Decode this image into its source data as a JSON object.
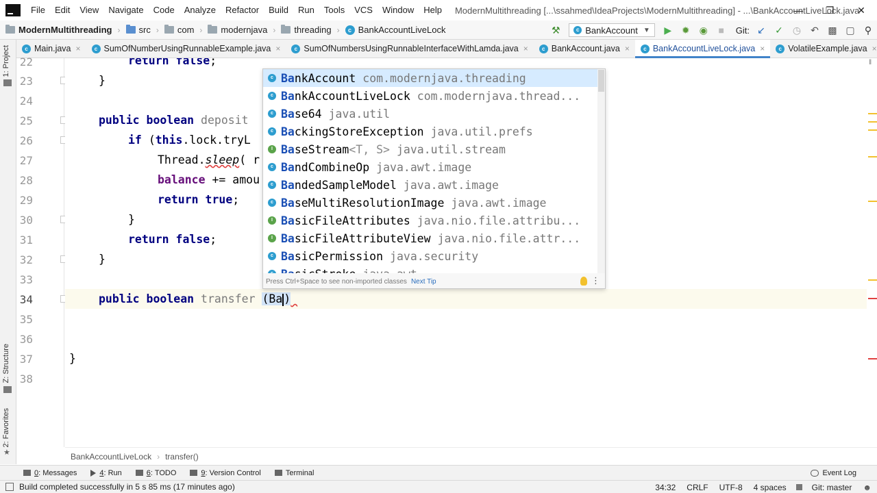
{
  "menu": {
    "items": [
      {
        "label": "File"
      },
      {
        "label": "Edit"
      },
      {
        "label": "View"
      },
      {
        "label": "Navigate"
      },
      {
        "label": "Code"
      },
      {
        "label": "Analyze"
      },
      {
        "label": "Refactor"
      },
      {
        "label": "Build"
      },
      {
        "label": "Run"
      },
      {
        "label": "Tools"
      },
      {
        "label": "VCS"
      },
      {
        "label": "Window"
      },
      {
        "label": "Help"
      }
    ],
    "window_title": "ModernMultithreading [...\\ssahmed\\IdeaProjects\\ModernMultithreading] - ...\\BankAccountLiveLock.java"
  },
  "navbar": {
    "project": "ModernMultithreading",
    "crumbs": [
      "src",
      "com",
      "modernjava",
      "threading",
      "BankAccountLiveLock"
    ],
    "run_config": "BankAccount",
    "git_label": "Git:"
  },
  "tabs": [
    {
      "label": "Main.java",
      "icon": "class-icon"
    },
    {
      "label": "SumOfNumberUsingRunnableExample.java",
      "icon": "class-icon"
    },
    {
      "label": "SumOfNumbersUsingRunnableInterfaceWithLamda.java",
      "icon": "class-icon"
    },
    {
      "label": "BankAccount.java",
      "icon": "class-icon"
    },
    {
      "label": "BankAccountLiveLock.java",
      "icon": "class-icon",
      "active": true
    },
    {
      "label": "VolatileExample.java",
      "icon": "class-icon"
    }
  ],
  "left_tools": {
    "project": "1: Project",
    "structure": "Z: Structure",
    "favorites": "2: Favorites"
  },
  "code": {
    "line_numbers": [
      "22",
      "23",
      "24",
      "25",
      "26",
      "27",
      "28",
      "29",
      "30",
      "31",
      "32",
      "33",
      "34",
      "35",
      "36",
      "37",
      "38"
    ],
    "current_line": "34",
    "lines": {
      "l22_kw": "return",
      "l22_kw2": "false",
      "l25_kw": "public",
      "l25_kw2": "boolean",
      "l25_name": "deposit",
      "l26_kw": "if",
      "l26_kw2": "this",
      "l26_rest": ".lock.tryL",
      "l27_cls": "Thread.",
      "l27_call": "sleep",
      "l27_rest": "( r",
      "l28_field": "balance",
      "l28_rest": " += amou",
      "l29_kw": "return",
      "l29_kw2": "true",
      "l31_kw": "return",
      "l31_kw2": "false",
      "l34_kw": "public",
      "l34_kw2": "boolean",
      "l34_name": "transfer",
      "l34_typed": "Ba",
      "brace_open": "{",
      "brace_close": "}",
      "semicolon": ";",
      "paren_close": ")",
      "paren_open": "("
    }
  },
  "completion": {
    "typed_prefix": "Ba",
    "items": [
      {
        "rest": "nkAccount",
        "generics": "",
        "package": "com.modernjava.threading",
        "kind": "class",
        "selected": true
      },
      {
        "rest": "nkAccountLiveLock",
        "generics": "",
        "package": "com.modernjava.thread...",
        "kind": "class"
      },
      {
        "rest": "se64",
        "generics": "",
        "package": "java.util",
        "kind": "class"
      },
      {
        "rest": "ckingStoreException",
        "generics": "",
        "package": "java.util.prefs",
        "kind": "class"
      },
      {
        "rest": "seStream",
        "generics": "<T, S>",
        "package": "java.util.stream",
        "kind": "interface"
      },
      {
        "rest": "ndCombineOp",
        "generics": "",
        "package": "java.awt.image",
        "kind": "class"
      },
      {
        "rest": "ndedSampleModel",
        "generics": "",
        "package": "java.awt.image",
        "kind": "class"
      },
      {
        "rest": "seMultiResolutionImage",
        "generics": "",
        "package": "java.awt.image",
        "kind": "class"
      },
      {
        "rest": "sicFileAttributes",
        "generics": "",
        "package": "java.nio.file.attribu...",
        "kind": "interface"
      },
      {
        "rest": "sicFileAttributeView",
        "generics": "",
        "package": "java.nio.file.attr...",
        "kind": "interface"
      },
      {
        "rest": "sicPermission",
        "generics": "",
        "package": "java.security",
        "kind": "class"
      },
      {
        "rest": "sicStroke",
        "generics": "",
        "package": "java.awt",
        "kind": "class"
      }
    ],
    "footer_hint": "Press Ctrl+Space to see non-imported classes",
    "footer_link": "Next Tip"
  },
  "method_breadcrumb": [
    "BankAccountLiveLock",
    "transfer()"
  ],
  "tool_windows": [
    {
      "num": "0",
      "label": ": Messages"
    },
    {
      "num": "4",
      "label": ": Run"
    },
    {
      "num": "6",
      "label": ": TODO"
    },
    {
      "num": "9",
      "label": ": Version Control"
    },
    {
      "num": "",
      "label": "Terminal"
    }
  ],
  "event_log": "Event Log",
  "status": {
    "message": "Build completed successfully in 5 s 85 ms (17 minutes ago)",
    "position": "34:32",
    "line_sep": "CRLF",
    "encoding": "UTF-8",
    "indent": "4 spaces",
    "git_branch": "Git: master"
  },
  "colors": {
    "keyword": "#000080",
    "field": "#660e7a",
    "accent": "#4083c9",
    "popup_selected": "#d6ebff",
    "current_line": "#fcfaed"
  }
}
